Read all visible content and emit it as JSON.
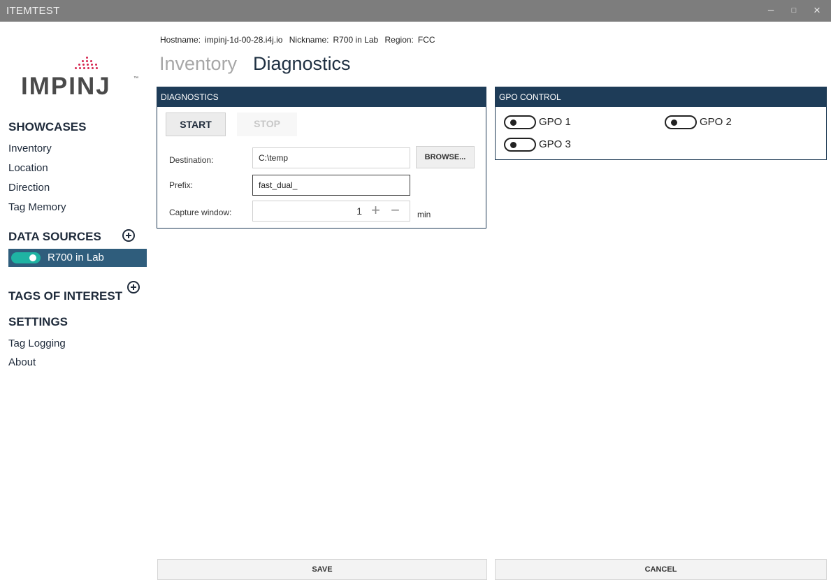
{
  "window": {
    "title": "ITEMTEST",
    "controls": {
      "minimize": "–",
      "maximize": "□",
      "close": "×"
    }
  },
  "brand": {
    "logo_text": "IMPINJ",
    "logo_tm": "™",
    "dot_color": "#d6264f"
  },
  "sidebar": {
    "showcases": {
      "heading": "SHOWCASES",
      "items": [
        "Inventory",
        "Location",
        "Direction",
        "Tag Memory"
      ]
    },
    "data_sources": {
      "heading": "DATA SOURCES",
      "items": [
        {
          "label": "R700 in Lab",
          "enabled": true
        }
      ]
    },
    "tags_of_interest": {
      "heading": "TAGS OF INTEREST"
    },
    "settings": {
      "heading": "SETTINGS",
      "items": [
        "Tag Logging",
        "About"
      ]
    }
  },
  "header": {
    "hostname_label": "Hostname:",
    "hostname_value": "impinj-1d-00-28.i4j.io",
    "nickname_label": "Nickname:",
    "nickname_value": "R700 in Lab",
    "region_label": "Region:",
    "region_value": "FCC",
    "tabs": [
      "Inventory",
      "Diagnostics"
    ],
    "active_tab": "Diagnostics"
  },
  "diagnostics": {
    "title": "DIAGNOSTICS",
    "start_label": "START",
    "stop_label": "STOP",
    "destination_label": "Destination:",
    "destination_value": "C:\\temp",
    "browse_label": "BROWSE...",
    "prefix_label": "Prefix:",
    "prefix_value": "fast_dual_",
    "capture_label": "Capture window:",
    "capture_value": "1",
    "capture_unit": "min",
    "plus_symbol": "+",
    "minus_symbol": "−"
  },
  "gpo_control": {
    "title": "GPO CONTROL",
    "items": [
      {
        "label": "GPO 1",
        "on": false
      },
      {
        "label": "GPO 2",
        "on": false
      },
      {
        "label": "GPO 3",
        "on": false
      }
    ]
  },
  "footer": {
    "save_label": "SAVE",
    "cancel_label": "CANCEL"
  },
  "colors": {
    "titlebar": "#7d7d7d",
    "panel_header": "#1e3c58",
    "selected_source": "#2f5d7c",
    "toggle_on": "#1fb3a3"
  }
}
